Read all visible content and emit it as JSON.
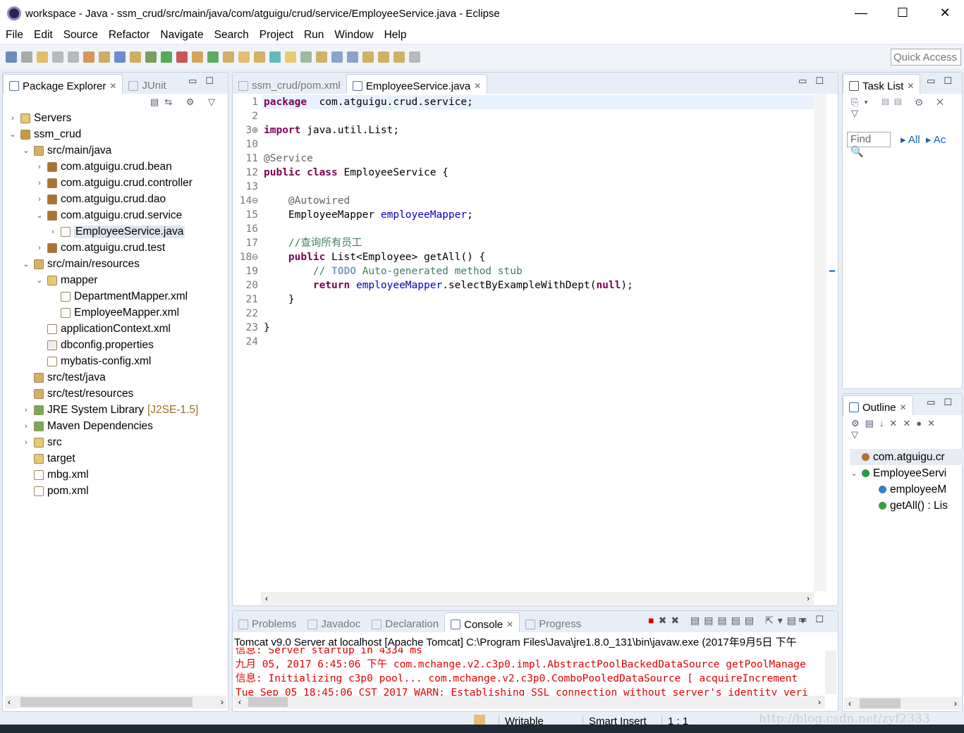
{
  "window": {
    "title": "workspace - Java - ssm_crud/src/main/java/com/atguigu/crud/service/EmployeeService.java - Eclipse",
    "minimize": "—",
    "maximize": "☐",
    "close": "✕"
  },
  "menu": [
    "File",
    "Edit",
    "Source",
    "Refactor",
    "Navigate",
    "Search",
    "Project",
    "Run",
    "Window",
    "Help"
  ],
  "toolbar": {
    "quick_access_placeholder": "Quick Access"
  },
  "left_panel": {
    "tabs": [
      {
        "label": "Package Explorer",
        "active": true
      },
      {
        "label": "JUnit",
        "active": false
      }
    ],
    "tree": [
      {
        "label": "Servers",
        "depth": 0,
        "arrow": "›",
        "icon": "folder-icon"
      },
      {
        "label": "ssm_crud",
        "depth": 0,
        "arrow": "⌄",
        "icon": "project-icon"
      },
      {
        "label": "src/main/java",
        "depth": 1,
        "arrow": "⌄",
        "icon": "source-folder-icon"
      },
      {
        "label": "com.atguigu.crud.bean",
        "depth": 2,
        "arrow": "›",
        "icon": "package-icon"
      },
      {
        "label": "com.atguigu.crud.controller",
        "depth": 2,
        "arrow": "›",
        "icon": "package-icon"
      },
      {
        "label": "com.atguigu.crud.dao",
        "depth": 2,
        "arrow": "›",
        "icon": "package-icon"
      },
      {
        "label": "com.atguigu.crud.service",
        "depth": 2,
        "arrow": "⌄",
        "icon": "package-icon"
      },
      {
        "label": "EmployeeService.java",
        "depth": 3,
        "arrow": "›",
        "icon": "java-file-icon",
        "selected": true
      },
      {
        "label": "com.atguigu.crud.test",
        "depth": 2,
        "arrow": "›",
        "icon": "package-icon"
      },
      {
        "label": "src/main/resources",
        "depth": 1,
        "arrow": "⌄",
        "icon": "source-folder-icon"
      },
      {
        "label": "mapper",
        "depth": 2,
        "arrow": "⌄",
        "icon": "folder-icon"
      },
      {
        "label": "DepartmentMapper.xml",
        "depth": 3,
        "arrow": "",
        "icon": "xml-file-icon"
      },
      {
        "label": "EmployeeMapper.xml",
        "depth": 3,
        "arrow": "",
        "icon": "xml-file-icon"
      },
      {
        "label": "applicationContext.xml",
        "depth": 2,
        "arrow": "",
        "icon": "xml-file-icon"
      },
      {
        "label": "dbconfig.properties",
        "depth": 2,
        "arrow": "",
        "icon": "file-icon"
      },
      {
        "label": "mybatis-config.xml",
        "depth": 2,
        "arrow": "",
        "icon": "xml-file-icon"
      },
      {
        "label": "src/test/java",
        "depth": 1,
        "arrow": "",
        "icon": "source-folder-icon"
      },
      {
        "label": "src/test/resources",
        "depth": 1,
        "arrow": "",
        "icon": "source-folder-icon"
      },
      {
        "label": "JRE System Library",
        "decoration": "[J2SE-1.5]",
        "depth": 1,
        "arrow": "›",
        "icon": "library-icon"
      },
      {
        "label": "Maven Dependencies",
        "depth": 1,
        "arrow": "›",
        "icon": "library-icon"
      },
      {
        "label": "src",
        "depth": 1,
        "arrow": "›",
        "icon": "folder-icon"
      },
      {
        "label": "target",
        "depth": 1,
        "arrow": "",
        "icon": "folder-icon"
      },
      {
        "label": "mbg.xml",
        "depth": 1,
        "arrow": "",
        "icon": "xml-file-icon"
      },
      {
        "label": "pom.xml",
        "depth": 1,
        "arrow": "",
        "icon": "maven-file-icon"
      }
    ]
  },
  "editor": {
    "tabs": [
      {
        "label": "ssm_crud/pom.xml",
        "active": false
      },
      {
        "label": "EmployeeService.java",
        "active": true
      }
    ],
    "lines": [
      {
        "n": "1",
        "seg": [
          [
            "kw",
            "package"
          ],
          [
            "",
            "  com.atguigu.crud.service;"
          ]
        ]
      },
      {
        "n": "2",
        "seg": []
      },
      {
        "n": "3⊕",
        "seg": [
          [
            "kw",
            "import"
          ],
          [
            "",
            " java.util.List;"
          ]
        ]
      },
      {
        "n": "10",
        "seg": []
      },
      {
        "n": "11",
        "seg": [
          [
            "ann",
            "@Service"
          ]
        ]
      },
      {
        "n": "12",
        "seg": [
          [
            "kw",
            "public class"
          ],
          [
            "",
            " EmployeeService {"
          ]
        ]
      },
      {
        "n": "13",
        "seg": []
      },
      {
        "n": "14⊖",
        "seg": [
          [
            "",
            "    "
          ],
          [
            "ann",
            "@Autowired"
          ]
        ]
      },
      {
        "n": "15",
        "seg": [
          [
            "",
            "    EmployeeMapper "
          ],
          [
            "fld",
            "employeeMapper"
          ],
          [
            "",
            ";"
          ]
        ]
      },
      {
        "n": "16",
        "seg": []
      },
      {
        "n": "17",
        "seg": [
          [
            "",
            "    "
          ],
          [
            "cmt",
            "//查询所有员工"
          ]
        ]
      },
      {
        "n": "18⊖",
        "seg": [
          [
            "",
            "    "
          ],
          [
            "kw",
            "public"
          ],
          [
            "",
            " List<Employee> getAll() {"
          ]
        ]
      },
      {
        "n": "19",
        "seg": [
          [
            "",
            "        "
          ],
          [
            "cmt",
            "// "
          ],
          [
            "todo",
            "TODO"
          ],
          [
            "cmt",
            " Auto-generated method stub"
          ]
        ]
      },
      {
        "n": "20",
        "seg": [
          [
            "",
            "        "
          ],
          [
            "kw",
            "return"
          ],
          [
            "",
            " "
          ],
          [
            "fld",
            "employeeMapper"
          ],
          [
            "",
            ".selectByExampleWithDept("
          ],
          [
            "kw",
            "null"
          ],
          [
            "",
            ");"
          ]
        ]
      },
      {
        "n": "21",
        "seg": [
          [
            "",
            "    }"
          ]
        ]
      },
      {
        "n": "22",
        "seg": []
      },
      {
        "n": "23",
        "seg": [
          [
            "",
            "}"
          ]
        ]
      },
      {
        "n": "24",
        "seg": []
      }
    ]
  },
  "task_list": {
    "tab": "Task List",
    "find_placeholder": "Find",
    "all": "All",
    "activate": "Ac"
  },
  "outline": {
    "tab": "Outline",
    "items": [
      {
        "label": "com.atguigu.cr",
        "depth": 0,
        "icon": "package-icon"
      },
      {
        "label": "EmployeeServi",
        "depth": 0,
        "icon": "class-icon",
        "arrow": "⌄"
      },
      {
        "label": "employeeM",
        "depth": 1,
        "icon": "field-icon"
      },
      {
        "label": "getAll() : Lis",
        "depth": 1,
        "icon": "method-icon"
      }
    ]
  },
  "console": {
    "tabs": [
      {
        "label": "Problems",
        "active": false
      },
      {
        "label": "Javadoc",
        "active": false
      },
      {
        "label": "Declaration",
        "active": false
      },
      {
        "label": "Console",
        "active": true
      },
      {
        "label": "Progress",
        "active": false
      }
    ],
    "header": "Tomcat v9.0 Server at localhost [Apache Tomcat] C:\\Program Files\\Java\\jre1.8.0_131\\bin\\javaw.exe (2017年9月5日 下午",
    "lines": [
      "信息: Server startup in 4334 ms",
      "九月 05, 2017 6:45:06 下午 com.mchange.v2.c3p0.impl.AbstractPoolBackedDataSource getPoolManage",
      "信息: Initializing c3p0 pool... com.mchange.v2.c3p0.ComboPooledDataSource [ acquireIncrement",
      "Tue Sep 05 18:45:06 CST 2017 WARN: Establishing SSL connection without server's identity veri"
    ]
  },
  "status": {
    "writable": "Writable",
    "insert_mode": "Smart Insert",
    "position": "1 : 1"
  },
  "watermark": "http://blog.csdn.net/zyf2333"
}
